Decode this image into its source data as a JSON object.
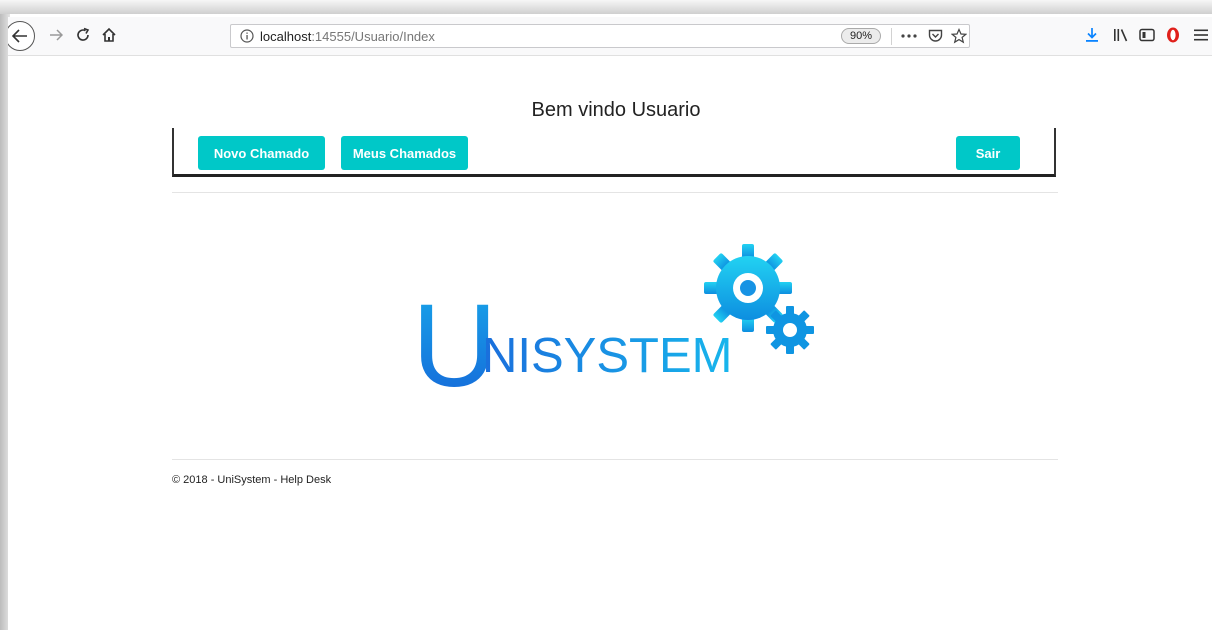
{
  "browser": {
    "url_host": "localhost",
    "url_path": ":14555/Usuario/Index",
    "zoom": "90%"
  },
  "page": {
    "welcome": "Bem vindo Usuario",
    "nav": {
      "new_ticket": "Novo Chamado",
      "my_tickets": "Meus Chamados",
      "logout": "Sair"
    },
    "logo": {
      "big_letter": "U",
      "rest": "NISYSTEM"
    },
    "footer": "© 2018 - UniSystem - Help Desk"
  },
  "colors": {
    "button": "#00c8c8",
    "logo_blue": "#1565d8",
    "logo_cyan": "#16c8ee",
    "download_blue": "#0a84ff",
    "opera_red": "#e0201b"
  },
  "icons": [
    "back-arrow-icon",
    "forward-arrow-icon",
    "reload-icon",
    "home-icon",
    "info-icon",
    "more-icon",
    "pocket-icon",
    "bookmark-star-icon",
    "download-icon",
    "library-icon",
    "sidebar-icon",
    "opera-icon",
    "menu-icon",
    "gear-icon"
  ]
}
